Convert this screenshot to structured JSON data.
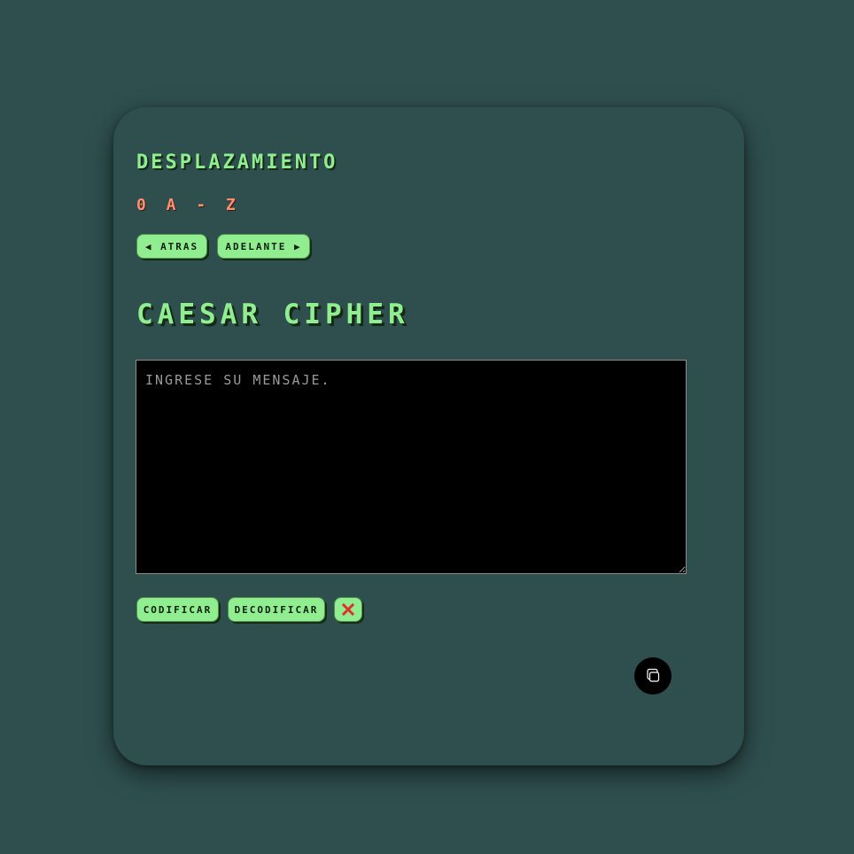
{
  "shift": {
    "label": "DESPLAZAMIENTO",
    "value": "0 A - Z",
    "back_label": "ATRAS",
    "forward_label": "ADELANTE"
  },
  "title": "CAESAR CIPHER",
  "message": {
    "value": "",
    "placeholder": "INGRESE SU MENSAJE."
  },
  "actions": {
    "encode_label": "CODIFICAR",
    "decode_label": "DECODIFICAR",
    "clear_icon": "close-icon",
    "copy_icon": "copy-icon"
  },
  "colors": {
    "background": "#2f4f4f",
    "accent": "#90ee90",
    "shift_value": "#ff8f6f",
    "clear_x": "#e0302a",
    "textarea_bg": "#000000"
  }
}
